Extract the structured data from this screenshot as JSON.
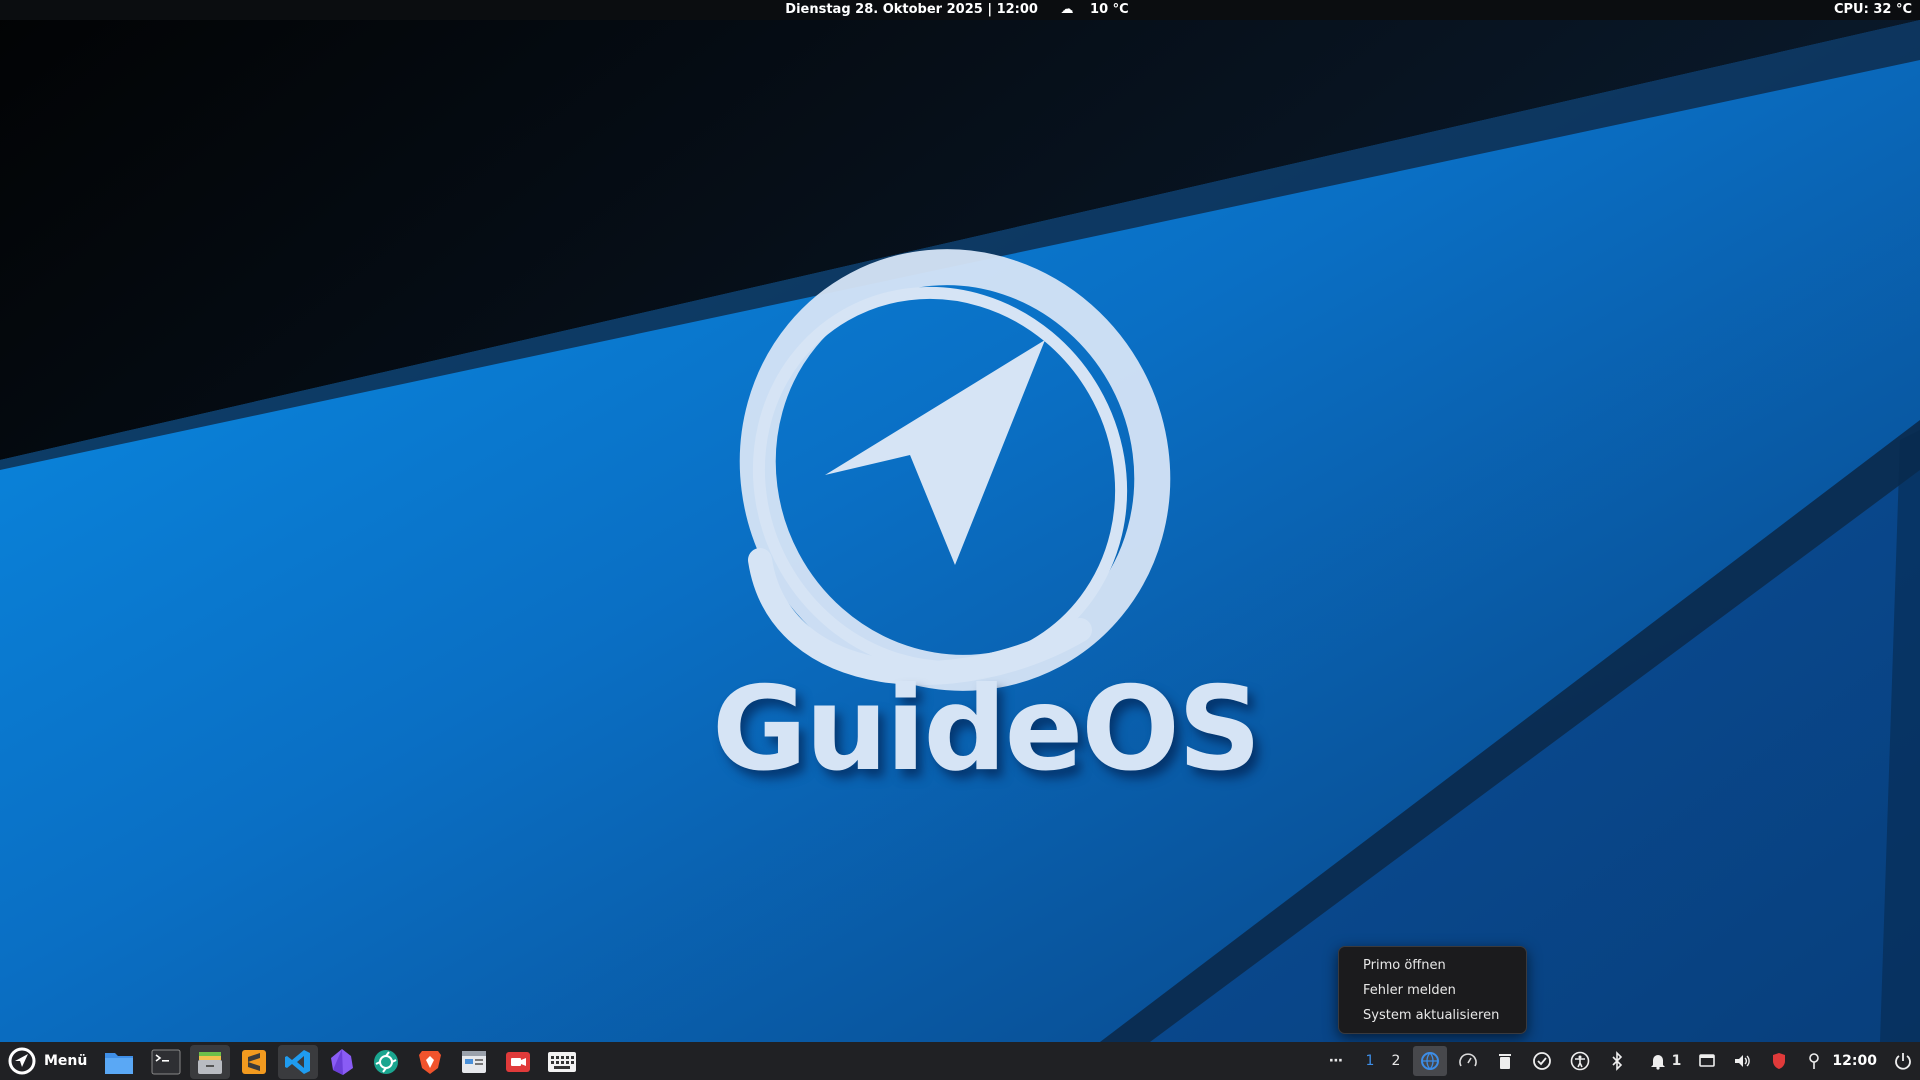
{
  "top_panel": {
    "datetime": "Dienstag 28. Oktober 2025 | 12:00",
    "weather": "10 °C",
    "weather_icon": "cloud-icon",
    "cpu": "CPU: 32 °C"
  },
  "desktop": {
    "logo_text": "GuideOS",
    "colors": {
      "primary": "#0a7fd6",
      "dark": "#05070a",
      "logo": "#d6e4f5"
    }
  },
  "context_menu": {
    "items": [
      "Primo öffnen",
      "Fehler melden",
      "System aktualisieren"
    ]
  },
  "taskbar": {
    "menu_label": "Menü",
    "launchers": [
      "file-manager-icon",
      "terminal-icon",
      "archive-manager-icon",
      "sublime-text-icon",
      "vscode-icon",
      "obsidian-icon",
      "photo-app-icon",
      "brave-browser-icon",
      "system-settings-icon",
      "screen-recorder-icon",
      "keyboard-icon"
    ],
    "tray": {
      "overflow": "⋯",
      "workspace_1": "1",
      "workspace_2": "2",
      "notification_count": "1",
      "clock": "12:00"
    }
  }
}
